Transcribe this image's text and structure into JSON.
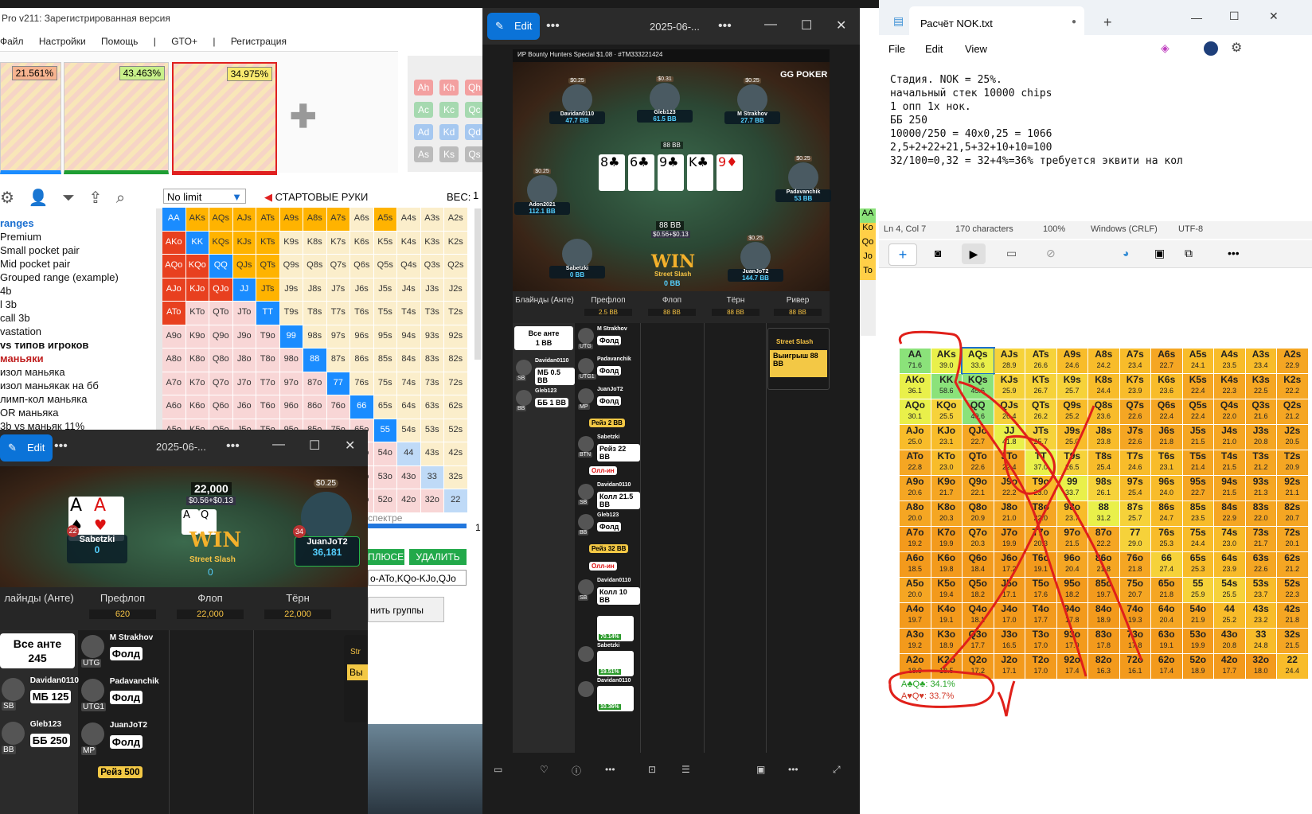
{
  "flopzilla": {
    "title": "Pro v211: Зарегистрированная версия",
    "menu": [
      "Файл",
      "Настройки",
      "Помощь",
      "|",
      "GTO+",
      "|",
      "Регистрация"
    ],
    "range_pcts": [
      "21.561%",
      "43.463%",
      "34.975%"
    ],
    "limit_select": "No limit",
    "start_hands_label": "СТАРТОВЫЕ РУКИ",
    "weight_label": "ВЕС:",
    "weight_value": "1",
    "spectrum_label": "спектре",
    "spectrum_value": "1",
    "btn_plusev": "ПЛЮСЕВЫЕ",
    "btn_delete": "УДАЛИТЬ",
    "range_text": "o-ATo,KQo-KJo,QJo",
    "btn_groups": "нить группы",
    "board_cards": [
      "Ah",
      "Kh",
      "Qh",
      "Ac",
      "Kc",
      "Qc",
      "Ad",
      "Kd",
      "Qd",
      "As",
      "Ks",
      "Qs"
    ],
    "side_list": [
      "ranges",
      "Premium",
      "Small pocket pair",
      "Mid pocket pair",
      "Grouped range (example)",
      "4b",
      "l 3b",
      "call 3b",
      "vastation",
      "vs типов игроков",
      "маньяки",
      "изол маньяка",
      "изол маньякак на бб",
      "лимп-кол маньяка",
      "OR маньяка",
      "3b vs маньяк 11%"
    ]
  },
  "hand_matrix": [
    [
      "AA",
      "AKs",
      "AQs",
      "AJs",
      "ATs",
      "A9s",
      "A8s",
      "A7s",
      "A6s",
      "A5s",
      "A4s",
      "A3s",
      "A2s"
    ],
    [
      "AKo",
      "KK",
      "KQs",
      "KJs",
      "KTs",
      "K9s",
      "K8s",
      "K7s",
      "K6s",
      "K5s",
      "K4s",
      "K3s",
      "K2s"
    ],
    [
      "AQo",
      "KQo",
      "QQ",
      "QJs",
      "QTs",
      "Q9s",
      "Q8s",
      "Q7s",
      "Q6s",
      "Q5s",
      "Q4s",
      "Q3s",
      "Q2s"
    ],
    [
      "AJo",
      "KJo",
      "QJo",
      "JJ",
      "JTs",
      "J9s",
      "J8s",
      "J7s",
      "J6s",
      "J5s",
      "J4s",
      "J3s",
      "J2s"
    ],
    [
      "ATo",
      "KTo",
      "QTo",
      "JTo",
      "TT",
      "T9s",
      "T8s",
      "T7s",
      "T6s",
      "T5s",
      "T4s",
      "T3s",
      "T2s"
    ],
    [
      "A9o",
      "K9o",
      "Q9o",
      "J9o",
      "T9o",
      "99",
      "98s",
      "97s",
      "96s",
      "95s",
      "94s",
      "93s",
      "92s"
    ],
    [
      "A8o",
      "K8o",
      "Q8o",
      "J8o",
      "T8o",
      "98o",
      "88",
      "87s",
      "86s",
      "85s",
      "84s",
      "83s",
      "82s"
    ],
    [
      "A7o",
      "K7o",
      "Q7o",
      "J7o",
      "T7o",
      "97o",
      "87o",
      "77",
      "76s",
      "75s",
      "74s",
      "73s",
      "72s"
    ],
    [
      "A6o",
      "K6o",
      "Q6o",
      "J6o",
      "T6o",
      "96o",
      "86o",
      "76o",
      "66",
      "65s",
      "64s",
      "63s",
      "62s"
    ],
    [
      "A5o",
      "K5o",
      "Q5o",
      "J5o",
      "T5o",
      "95o",
      "85o",
      "75o",
      "65o",
      "55",
      "54s",
      "53s",
      "52s"
    ],
    [
      "A4o",
      "K4o",
      "Q4o",
      "J4o",
      "T4o",
      "94o",
      "84o",
      "74o",
      "64o",
      "54o",
      "44",
      "43s",
      "42s"
    ],
    [
      "A3o",
      "K3o",
      "Q3o",
      "J3o",
      "T3o",
      "93o",
      "83o",
      "73o",
      "63o",
      "53o",
      "43o",
      "33",
      "32s"
    ],
    [
      "A2o",
      "K2o",
      "Q2o",
      "J2o",
      "T2o",
      "92o",
      "82o",
      "72o",
      "62o",
      "52o",
      "42o",
      "32o",
      "22"
    ]
  ],
  "equity_values": [
    [
      "71.6",
      "39.0",
      "33.6",
      "28.9",
      "26.6",
      "24.6",
      "24.2",
      "23.4",
      "22.7",
      "24.1",
      "23.5",
      "23.4",
      "22.9"
    ],
    [
      "36.1",
      "58.6",
      "45.6",
      "25.9",
      "26.7",
      "25.7",
      "24.4",
      "23.9",
      "23.6",
      "22.4",
      "22.3",
      "22.5",
      "22.2"
    ],
    [
      "30.1",
      "25.5",
      "49.6",
      "26.4",
      "26.2",
      "25.2",
      "23.6",
      "22.6",
      "22.4",
      "22.4",
      "22.0",
      "21.6",
      "21.2"
    ],
    [
      "25.0",
      "23.1",
      "22.7",
      "41.8",
      "25.7",
      "25.0",
      "23.8",
      "22.6",
      "21.8",
      "21.5",
      "21.0",
      "20.8",
      "20.5"
    ],
    [
      "22.8",
      "23.0",
      "22.6",
      "22.4",
      "37.0",
      "26.5",
      "25.4",
      "24.6",
      "23.1",
      "21.4",
      "21.5",
      "21.2",
      "20.9"
    ],
    [
      "20.6",
      "21.7",
      "22.1",
      "22.2",
      "23.0",
      "33.7",
      "26.1",
      "25.4",
      "24.0",
      "22.7",
      "21.5",
      "21.3",
      "21.1"
    ],
    [
      "20.0",
      "20.3",
      "20.9",
      "21.0",
      "22.0",
      "23.7",
      "31.2",
      "25.7",
      "24.7",
      "23.5",
      "22.9",
      "22.0",
      "20.7"
    ],
    [
      "19.2",
      "19.9",
      "20.3",
      "19.9",
      "20.3",
      "21.5",
      "22.2",
      "29.0",
      "25.3",
      "24.4",
      "23.0",
      "21.7",
      "20.1"
    ],
    [
      "18.5",
      "19.8",
      "18.4",
      "17.2",
      "19.1",
      "20.4",
      "21.8",
      "21.8",
      "27.4",
      "25.3",
      "23.9",
      "22.6",
      "21.2"
    ],
    [
      "20.0",
      "19.4",
      "18.2",
      "17.1",
      "17.6",
      "18.2",
      "19.7",
      "20.7",
      "21.8",
      "25.9",
      "25.5",
      "23.7",
      "22.3"
    ],
    [
      "19.7",
      "19.1",
      "18.1",
      "17.0",
      "17.7",
      "17.8",
      "18.9",
      "19.3",
      "20.4",
      "21.9",
      "25.2",
      "23.2",
      "21.8"
    ],
    [
      "19.2",
      "18.9",
      "17.7",
      "16.5",
      "17.0",
      "17.0",
      "17.8",
      "17.8",
      "19.1",
      "19.9",
      "20.8",
      "24.8",
      "21.5"
    ],
    [
      "18.9",
      "18.5",
      "17.2",
      "17.1",
      "17.0",
      "17.4",
      "16.3",
      "16.1",
      "17.4",
      "18.9",
      "17.7",
      "18.0",
      "24.4"
    ]
  ],
  "combo_equity": [
    {
      "label": "A♣Q♣: 34.1%"
    },
    {
      "label": "A♥Q♥: 33.7%"
    }
  ],
  "photo_main": {
    "edit_label": "Edit",
    "title": "2025-06-...",
    "tournament": "ИР  Bounty Hunters Special $1.08 · #TM333221424",
    "brand": "GG POKER",
    "pot": "88 BB",
    "board": [
      "8♣",
      "6♣",
      "9♣",
      "K♣",
      "9♦"
    ],
    "winner_bounty": "$0.56+$0.13",
    "winner_label": "WIN",
    "winner_sub": "Street Slash",
    "winner_amt": "0 BB",
    "players": [
      {
        "name": "Davidan0110",
        "stack": "47.7 BB",
        "bounty": "$0.25"
      },
      {
        "name": "Gleb123",
        "stack": "61.5 BB",
        "bounty": "$0.31"
      },
      {
        "name": "M Strakhov",
        "stack": "27.7 BB",
        "bounty": "$0.25"
      },
      {
        "name": "Adon2021",
        "stack": "112.1 BB",
        "bounty": "$0.25"
      },
      {
        "name": "Padavanchik",
        "stack": "53 BB",
        "bounty": "$0.25"
      },
      {
        "name": "Sabetzki",
        "stack": "0 BB",
        "bounty": ""
      },
      {
        "name": "JuanJoT2",
        "stack": "144.7 BB",
        "bounty": "$0.25"
      }
    ],
    "columns": [
      {
        "head": "Блайнды (Анте)",
        "val": ""
      },
      {
        "head": "Префлоп",
        "val": "2.5 BB"
      },
      {
        "head": "Флоп",
        "val": "88 BB"
      },
      {
        "head": "Тёрн",
        "val": "88 BB"
      },
      {
        "head": "Ривер",
        "val": "88 BB"
      }
    ],
    "ante_label": "Все анте",
    "ante_value": "1 BB",
    "blinds": [
      {
        "name": "Davidan0110",
        "pos": "SB",
        "act": "МБ 0.5 BB"
      },
      {
        "name": "Gleb123",
        "pos": "BB",
        "act": "ББ 1 BB"
      }
    ],
    "preflop": [
      {
        "name": "M Strakhov",
        "pos": "UTG",
        "act": "Фолд"
      },
      {
        "name": "Padavanchik",
        "pos": "UTG1",
        "act": "Фолд"
      },
      {
        "name": "JuanJoT2",
        "pos": "MP",
        "act": "Фолд"
      },
      {
        "name": "",
        "pos": "",
        "act": "Рейз 2 BB"
      },
      {
        "name": "Sabetzki",
        "pos": "BTN",
        "act": "Рейз 22 BB"
      },
      {
        "name": "",
        "pos": "",
        "act": "Олл-ин"
      },
      {
        "name": "Davidan0110",
        "pos": "SB",
        "act": "Колл 21.5 BB"
      },
      {
        "name": "Gleb123",
        "pos": "BB",
        "act": "Фолд"
      },
      {
        "name": "",
        "pos": "",
        "act": "Рейз 32 BB"
      },
      {
        "name": "",
        "pos": "",
        "act": "Олл-ин"
      },
      {
        "name": "Davidan0110",
        "pos": "SB",
        "act": "Колл 10 BB"
      }
    ],
    "equities": [
      "70.14%",
      "19.51%",
      "10.36%"
    ],
    "equity_names": [
      "",
      "Sabetzki",
      "Davidan0110"
    ],
    "river_winner": "Street Slash",
    "river_won": "Выигрыш 88 BB"
  },
  "photo_small": {
    "edit_label": "Edit",
    "title": "2025-06-...",
    "pot": "22,000",
    "winner_bounty": "$0.56+$0.13",
    "winner_label": "WIN",
    "winner_sub": "Street Slash",
    "winner_amt": "0",
    "players": [
      {
        "name": "Sabetzki",
        "stack": "0",
        "level": "22"
      },
      {
        "name": "JuanJoT2",
        "stack": "36,181",
        "level": "34",
        "bounty": "$0.25"
      }
    ],
    "columns": [
      {
        "head": "лайнды (Анте)",
        "val": ""
      },
      {
        "head": "Префлоп",
        "val": "620"
      },
      {
        "head": "Флоп",
        "val": "22,000"
      },
      {
        "head": "Тёрн",
        "val": "22,000"
      }
    ],
    "ante_label": "Все анте",
    "ante_value": "245",
    "blinds": [
      {
        "name": "Davidan0110",
        "pos": "SB",
        "act": "МБ 125"
      },
      {
        "name": "Gleb123",
        "pos": "BB",
        "act": "ББ 250"
      }
    ],
    "preflop": [
      {
        "name": "M Strakhov",
        "pos": "UTG",
        "act": "Фолд"
      },
      {
        "name": "Padavanchik",
        "pos": "UTG1",
        "act": "Фолд"
      },
      {
        "name": "JuanJoT2",
        "pos": "MP",
        "act": "Фолд"
      },
      {
        "name": "",
        "pos": "",
        "act": "Рейз 500"
      }
    ],
    "river_peek": [
      "Str",
      "Вы"
    ]
  },
  "notepad": {
    "tab_title": "Расчёт NOK.txt",
    "menu": [
      "File",
      "Edit",
      "View"
    ],
    "lines": [
      "Стадия. NOK = 25%.",
      "начальный стек 10000 chips",
      "1 опп 1х нок.",
      "ББ 250",
      "10000/250 = 40x0,25 = 1066",
      "2,5+2+22+21,5+32+10+10=100",
      "32/100=0,32 = 32+4%=36% требуется эквити на кол"
    ],
    "status": [
      "Ln 4, Col 7",
      "170 characters",
      "100%",
      "Windows (CRLF)",
      "UTF-8"
    ]
  },
  "colors": {
    "accent": "#0b73d8",
    "flopz_blue": "#1a8cff",
    "red_ink": "#e0201a"
  }
}
